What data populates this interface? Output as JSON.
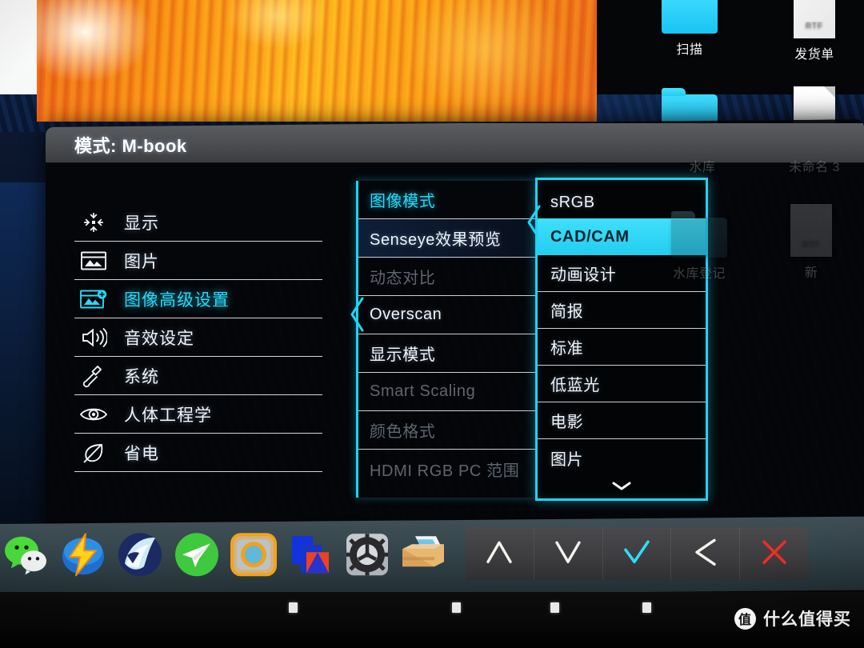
{
  "osd": {
    "title": "模式: M-book",
    "accent_color": "#1fd3f5",
    "selected_color": "#3fe0fb",
    "sidebar": [
      {
        "label": "显示",
        "icon": "shrink-arrows-icon",
        "state": "normal"
      },
      {
        "label": "图片",
        "icon": "picture-icon",
        "state": "normal"
      },
      {
        "label": "图像高级设置",
        "icon": "picture-plus-icon",
        "state": "active"
      },
      {
        "label": "音效设定",
        "icon": "speaker-icon",
        "state": "normal"
      },
      {
        "label": "系统",
        "icon": "wrench-icon",
        "state": "normal"
      },
      {
        "label": "人体工程学",
        "icon": "eye-icon",
        "state": "normal"
      },
      {
        "label": "省电",
        "icon": "leaf-icon",
        "state": "normal"
      }
    ],
    "options": [
      {
        "label": "图像模式",
        "state": "active"
      },
      {
        "label": "Senseye效果预览",
        "state": "tinted"
      },
      {
        "label": "动态对比",
        "state": "disabled"
      },
      {
        "label": "Overscan",
        "state": "normal"
      },
      {
        "label": "显示模式",
        "state": "normal"
      },
      {
        "label": "Smart Scaling",
        "state": "disabled"
      },
      {
        "label": "颜色格式",
        "state": "disabled"
      },
      {
        "label": "HDMI RGB PC 范围",
        "state": "disabled"
      }
    ],
    "values": [
      {
        "label": "sRGB",
        "state": "normal"
      },
      {
        "label": "CAD/CAM",
        "state": "selected"
      },
      {
        "label": "动画设计",
        "state": "normal"
      },
      {
        "label": "简报",
        "state": "normal"
      },
      {
        "label": "标准",
        "state": "normal"
      },
      {
        "label": "低蓝光",
        "state": "normal"
      },
      {
        "label": "电影",
        "state": "normal"
      },
      {
        "label": "图片",
        "state": "normal"
      }
    ],
    "scroll_indicator": "chevron-down-icon",
    "buttons": [
      {
        "name": "up-button",
        "icon": "chevron-up-icon",
        "color": "#f4f2ec"
      },
      {
        "name": "down-button",
        "icon": "chevron-down-icon",
        "color": "#f4f2ec"
      },
      {
        "name": "confirm-button",
        "icon": "check-icon",
        "color": "#2ddcf5"
      },
      {
        "name": "back-button",
        "icon": "chevron-left-icon",
        "color": "#f4f2ec"
      },
      {
        "name": "exit-button",
        "icon": "close-x-icon",
        "color": "#ee2d25"
      }
    ]
  },
  "desktop": {
    "icons": [
      {
        "label": "扫描",
        "type": "folder",
        "behind_osd": false
      },
      {
        "label": "发货单",
        "type": "document",
        "ext": "RTF",
        "behind_osd": false
      },
      {
        "label": "水库",
        "type": "folder",
        "behind_osd": true
      },
      {
        "label": "未命名 3",
        "type": "document",
        "behind_osd": true
      },
      {
        "label": "水库登记",
        "type": "folder",
        "behind_osd": true
      },
      {
        "label": "新",
        "type": "document",
        "ext": "RTF",
        "behind_osd": true
      }
    ]
  },
  "dock": {
    "apps": [
      {
        "name": "wechat-icon",
        "color": "#4ddf3e"
      },
      {
        "name": "thunder-download-icon",
        "color": "#1f6fd0"
      },
      {
        "name": "sequel-pro-icon",
        "color": "#1b2a63"
      },
      {
        "name": "telegram-icon",
        "color": "#3fc93f"
      },
      {
        "name": "browser-icon",
        "color": "#e8a031"
      },
      {
        "name": "vmware-fusion-icon",
        "color": "#1232df"
      },
      {
        "name": "system-preferences-icon",
        "color": "#8e9196"
      },
      {
        "name": "finder-archive-icon",
        "color": "#d79a4e"
      }
    ]
  },
  "watermark": {
    "logo_char": "值",
    "text": "什么值得买"
  }
}
